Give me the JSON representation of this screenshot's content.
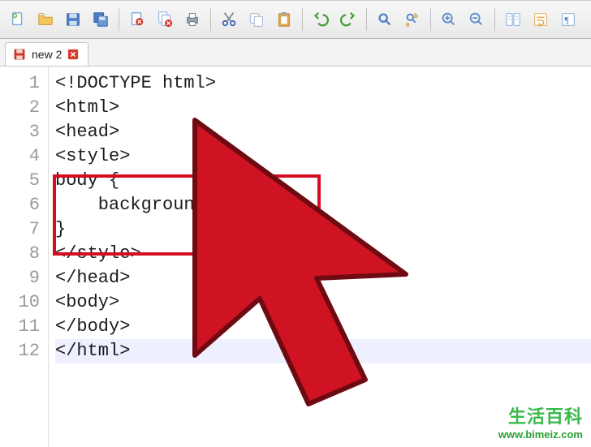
{
  "tabs": [
    {
      "label": "new 2"
    }
  ],
  "code": {
    "lines": [
      "<!DOCTYPE html>",
      "<html>",
      "<head>",
      "<style>",
      "body {",
      "    background-color:",
      "}",
      "</style>",
      "</head>",
      "<body>",
      "</body>",
      "</html>"
    ]
  },
  "watermark": {
    "title": "生活百科",
    "url": "www.bimeiz.com"
  },
  "toolbar_icons": [
    "new-file-icon",
    "open-file-icon",
    "save-icon",
    "save-all-icon",
    "close-icon",
    "close-all-icon",
    "print-icon",
    "cut-icon",
    "copy-icon",
    "paste-icon",
    "undo-icon",
    "redo-icon",
    "find-icon",
    "replace-icon",
    "zoom-in-icon",
    "zoom-out-icon",
    "sync-scroll-icon",
    "word-wrap-icon",
    "show-all-chars-icon"
  ]
}
